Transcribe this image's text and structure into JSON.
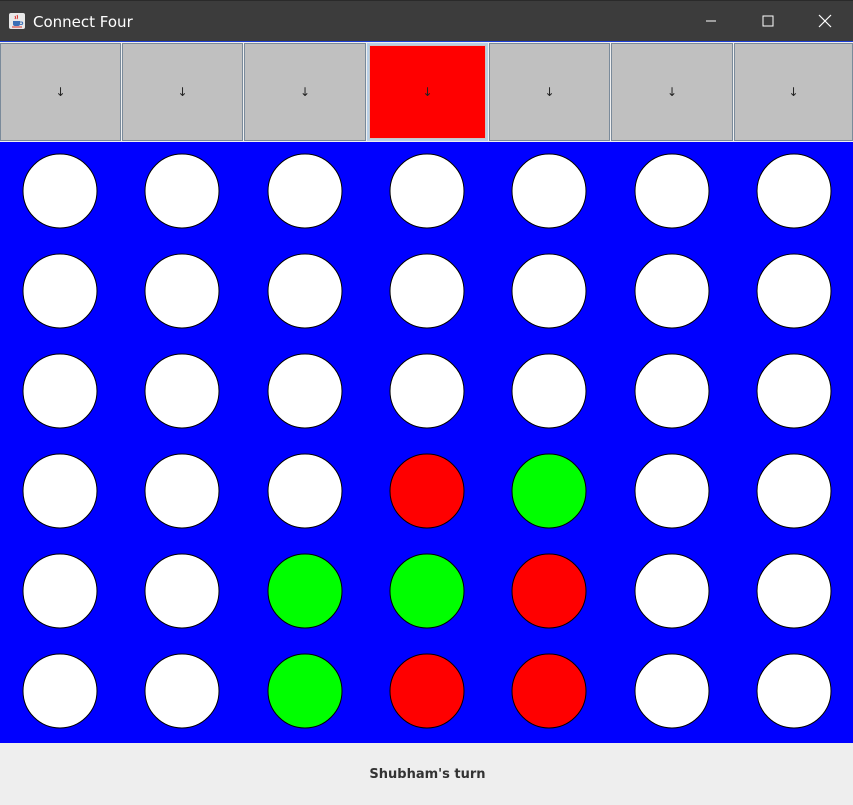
{
  "window": {
    "title": "Connect Four",
    "icon": "java-cup-icon",
    "controls": [
      "minimize-icon",
      "maximize-icon",
      "close-icon"
    ]
  },
  "columns": [
    {
      "label": "↓",
      "icon": "arrow-down-icon",
      "active": false
    },
    {
      "label": "↓",
      "icon": "arrow-down-icon",
      "active": false
    },
    {
      "label": "↓",
      "icon": "arrow-down-icon",
      "active": false
    },
    {
      "label": "↓",
      "icon": "arrow-down-icon",
      "active": true
    },
    {
      "label": "↓",
      "icon": "arrow-down-icon",
      "active": false
    },
    {
      "label": "↓",
      "icon": "arrow-down-icon",
      "active": false
    },
    {
      "label": "↓",
      "icon": "arrow-down-icon",
      "active": false
    }
  ],
  "board": {
    "rows": 6,
    "cols": 7,
    "cells": [
      [
        "empty",
        "empty",
        "empty",
        "empty",
        "empty",
        "empty",
        "empty"
      ],
      [
        "empty",
        "empty",
        "empty",
        "empty",
        "empty",
        "empty",
        "empty"
      ],
      [
        "empty",
        "empty",
        "empty",
        "empty",
        "empty",
        "empty",
        "empty"
      ],
      [
        "empty",
        "empty",
        "empty",
        "red",
        "green",
        "empty",
        "empty"
      ],
      [
        "empty",
        "empty",
        "green",
        "green",
        "red",
        "empty",
        "empty"
      ],
      [
        "empty",
        "empty",
        "green",
        "red",
        "red",
        "empty",
        "empty"
      ]
    ]
  },
  "status": {
    "text": "Shubham's turn"
  },
  "colors": {
    "titlebar": "#3c3c3c",
    "board": "#0000ff",
    "empty": "#ffffff",
    "red": "#ff0000",
    "green": "#00ff00",
    "button": "#c0c0c0",
    "active_button": "#ff0000",
    "status_bar": "#eeeeee"
  }
}
